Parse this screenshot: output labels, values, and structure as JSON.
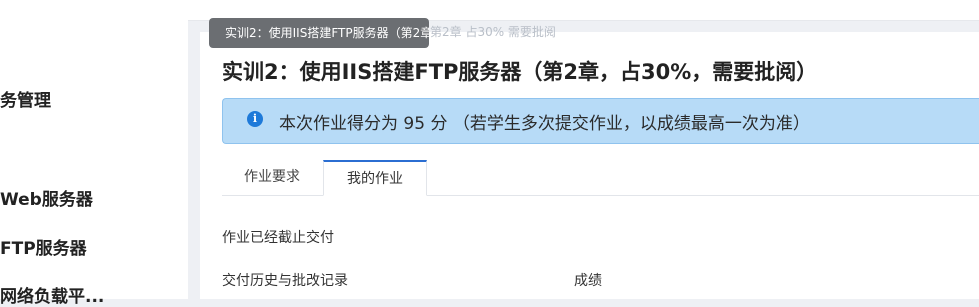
{
  "sidebar": {
    "items": [
      {
        "label": "务管理"
      },
      {
        "label": "Web服务器"
      },
      {
        "label": "FTP服务器"
      },
      {
        "label": "网络负载平..."
      }
    ]
  },
  "breadcrumb_ghost": "第2章  占30%  需要批阅",
  "tooltip": "实训2：使用IIS搭建FTP服务器（第2章，占30%，需要批阅）",
  "page_title": "实训2：使用IIS搭建FTP服务器（第2章，占30%，需要批阅）",
  "alert": {
    "icon": "info-icon",
    "text": "本次作业得分为 95 分 （若学生多次提交作业，以成绩最高一次为准）"
  },
  "tabs": [
    {
      "label": "作业要求"
    },
    {
      "label": "我的作业"
    }
  ],
  "status_text": "作业已经截止交付",
  "history_label": "交付历史与批改记录",
  "score_label": "成绩"
}
